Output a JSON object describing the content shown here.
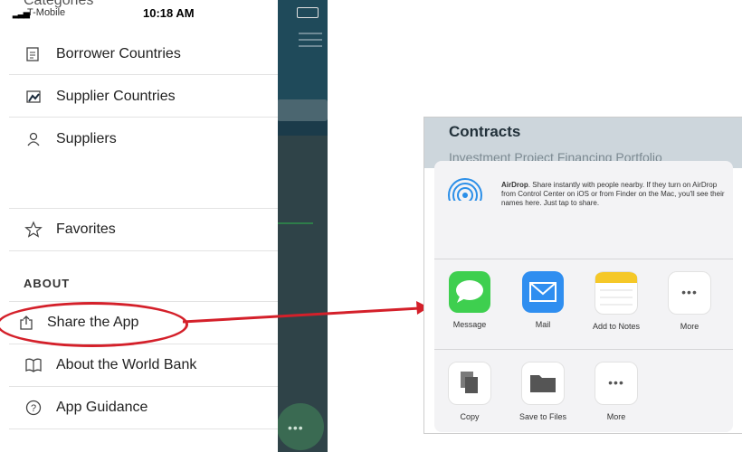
{
  "status_bar": {
    "carrier": "T-Mobile",
    "time": "10:18 AM"
  },
  "drawer": {
    "partial_item": "Categories",
    "items": [
      {
        "label": "Borrower Countries",
        "icon": "document-icon"
      },
      {
        "label": "Supplier Countries",
        "icon": "map-icon"
      },
      {
        "label": "Suppliers",
        "icon": "user-icon"
      },
      {
        "label": "Favorites",
        "icon": "star-icon"
      }
    ],
    "about_heading": "ABOUT",
    "about_items": [
      {
        "label": "Share the App",
        "icon": "share-icon"
      },
      {
        "label": "About the World Bank",
        "icon": "book-icon"
      },
      {
        "label": "App Guidance",
        "icon": "help-icon"
      }
    ]
  },
  "annotation": {
    "highlight_color": "#d4202a"
  },
  "share_screen": {
    "title": "Contracts",
    "subtitle": "Investment Project Financing Portfolio",
    "airdrop": {
      "title": "AirDrop",
      "text": ". Share instantly with people nearby. If they turn on AirDrop from Control Center on iOS or from Finder on the Mac, you'll see their names here. Just tap to share."
    },
    "apps": [
      {
        "label": "Message",
        "color": "#3ecf4f"
      },
      {
        "label": "Mail",
        "color": "#2f8ef0"
      },
      {
        "label": "Add to Notes",
        "color": "#f5c828"
      },
      {
        "label": "More",
        "color": "#ffffff"
      }
    ],
    "actions": [
      {
        "label": "Copy"
      },
      {
        "label": "Save to Files"
      },
      {
        "label": "More"
      }
    ]
  }
}
